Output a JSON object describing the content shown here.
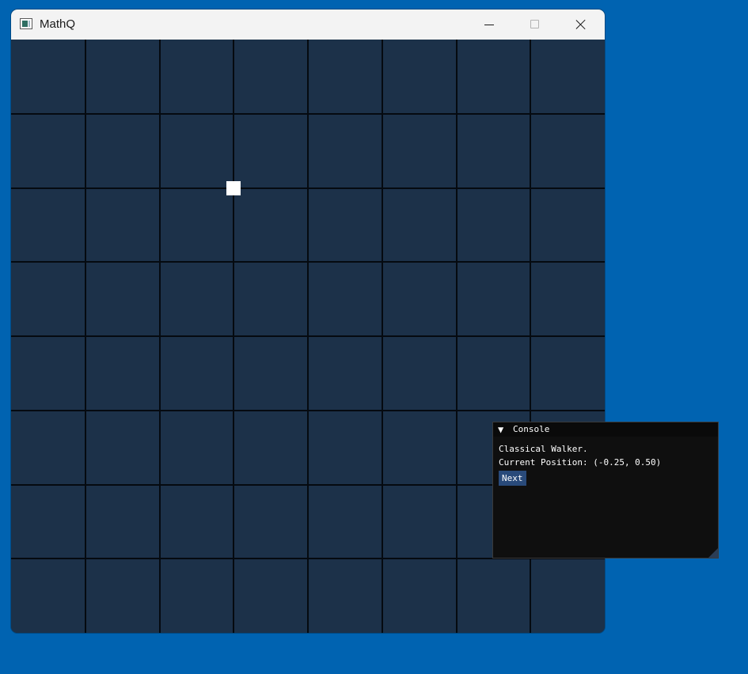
{
  "window": {
    "title": "MathQ",
    "app_icon": "window-app-icon",
    "controls": {
      "minimize_icon": "minimize-icon",
      "maximize_icon": "maximize-icon",
      "close_icon": "close-icon"
    }
  },
  "canvas": {
    "grid_divisions": 8,
    "background_color": "#1c3149",
    "grid_line_color": "#050a10",
    "walker_color": "#ffffff"
  },
  "walker": {
    "position": [
      -0.25,
      0.5
    ]
  },
  "console": {
    "title": "Console",
    "collapse_icon": "▼",
    "lines": [
      "Classical Walker.",
      "Current Position: (-0.25, 0.50)"
    ],
    "next_label": "Next"
  },
  "colors": {
    "desktop_background": "#0063b1",
    "titlebar_background": "#f3f3f3",
    "console_background": "#0f0f0f",
    "button_background": "#294a7a"
  }
}
